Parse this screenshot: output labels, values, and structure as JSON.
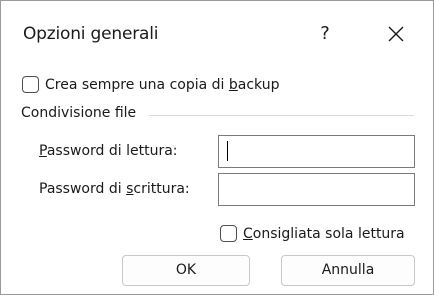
{
  "dialog": {
    "title": "Opzioni generali",
    "help_label": "?",
    "close_icon": "close-icon"
  },
  "backup": {
    "label_pre": "Crea sempre una copia di ",
    "label_accel": "b",
    "label_post": "ackup",
    "checked": false
  },
  "sharing": {
    "group_label": "Condivisione file",
    "read_password": {
      "label_accel": "P",
      "label_post": "assword di lettura:",
      "value": ""
    },
    "write_password": {
      "label_pre": "Password di ",
      "label_accel": "s",
      "label_post": "crittura:",
      "value": ""
    },
    "readonly_recommended": {
      "label_accel": "C",
      "label_post": "onsigliata sola lettura",
      "checked": false
    }
  },
  "buttons": {
    "ok": "OK",
    "cancel": "Annulla"
  }
}
